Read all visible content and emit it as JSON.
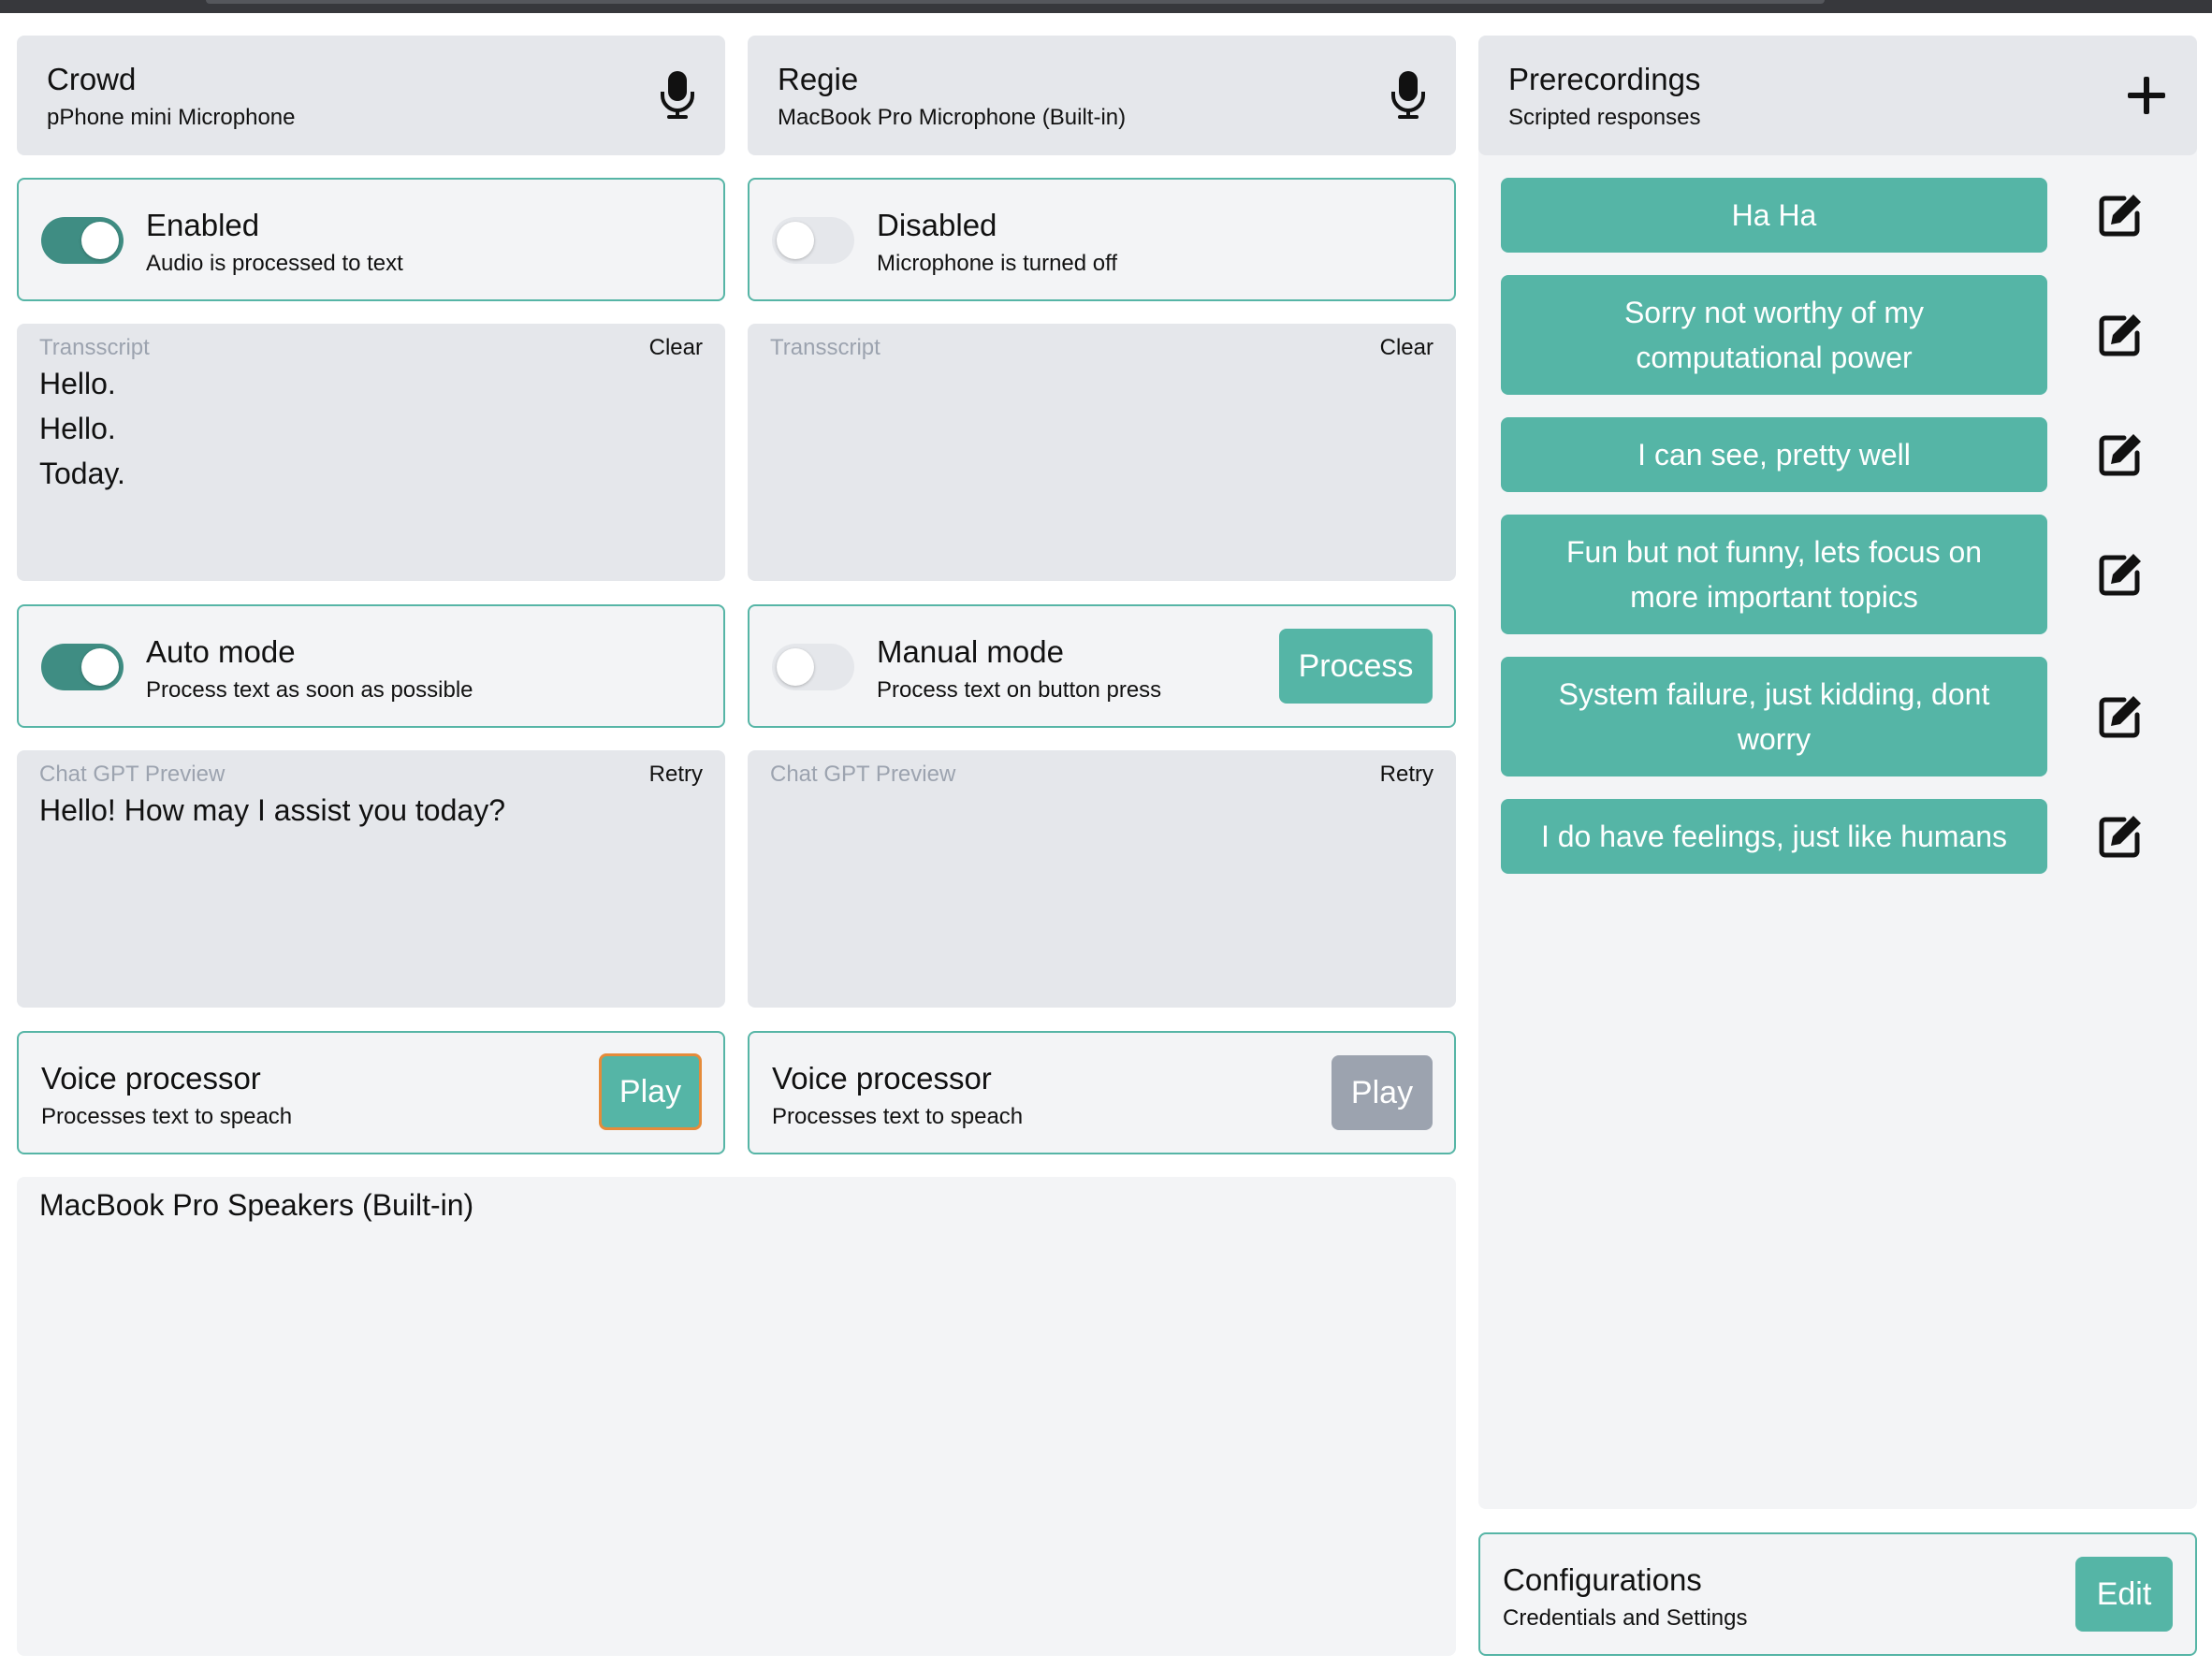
{
  "channels": [
    {
      "title": "Crowd",
      "device": "pPhone mini Microphone",
      "status": {
        "title": "Enabled",
        "subtitle": "Audio is processed to text",
        "on": true
      },
      "transcript": {
        "label": "Transscript",
        "action": "Clear",
        "lines": [
          "Hello.",
          "Hello.",
          "Today."
        ]
      },
      "mode": {
        "title": "Auto mode",
        "subtitle": "Process text as soon as possible",
        "on": true,
        "button": ""
      },
      "preview": {
        "label": "Chat GPT Preview",
        "action": "Retry",
        "text": "Hello! How may I assist you today?"
      },
      "voice": {
        "title": "Voice processor",
        "subtitle": "Processes text to speach",
        "button": "Play",
        "enabled": true
      }
    },
    {
      "title": "Regie",
      "device": "MacBook Pro Microphone (Built-in)",
      "status": {
        "title": "Disabled",
        "subtitle": "Microphone is turned off",
        "on": false
      },
      "transcript": {
        "label": "Transscript",
        "action": "Clear",
        "lines": []
      },
      "mode": {
        "title": "Manual mode",
        "subtitle": "Process text on button press",
        "on": false,
        "button": "Process"
      },
      "preview": {
        "label": "Chat GPT Preview",
        "action": "Retry",
        "text": ""
      },
      "voice": {
        "title": "Voice processor",
        "subtitle": "Processes text to speach",
        "button": "Play",
        "enabled": false
      }
    }
  ],
  "output": {
    "device": "MacBook Pro Speakers (Built-in)"
  },
  "prerecordings": {
    "title": "Prerecordings",
    "subtitle": "Scripted responses",
    "add_icon": "plus-icon",
    "items": [
      {
        "label": "Ha Ha"
      },
      {
        "label": "Sorry not worthy of my computational power"
      },
      {
        "label": "I can see, pretty well"
      },
      {
        "label": "Fun but not funny, lets focus on more important topics"
      },
      {
        "label": "System failure, just kidding, dont worry"
      },
      {
        "label": "I do have feelings, just like humans"
      }
    ],
    "edit_icon": "edit-icon"
  },
  "configurations": {
    "title": "Configurations",
    "subtitle": "Credentials and Settings",
    "button": "Edit"
  },
  "colors": {
    "accent": "#55b5a6",
    "toggle_on": "#3f8d83",
    "disabled_button": "#9ca3af",
    "panel": "#e5e7eb",
    "panel_light": "#f3f4f6",
    "focus_ring": "#e58b3a"
  }
}
